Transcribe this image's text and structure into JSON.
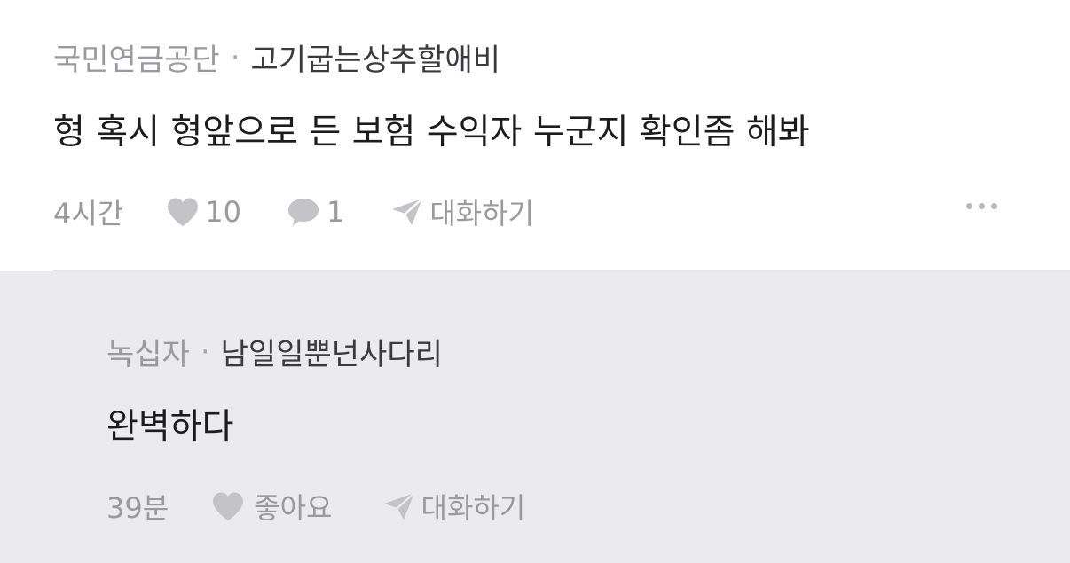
{
  "comment": {
    "company": "국민연금공단",
    "separator": "·",
    "nickname": "고기굽는상추할애비",
    "body": "형 혹시 형앞으로 든 보험 수익자 누군지 확인좀 해봐",
    "time": "4시간",
    "likes": "10",
    "replies": "1",
    "chat_label": "대화하기",
    "icons": {
      "like": "heart-icon",
      "reply": "speech-bubble-icon",
      "chat": "paper-plane-icon",
      "more": "more-dots-icon"
    }
  },
  "reply": {
    "company": "녹십자",
    "separator": "·",
    "nickname": "남일일뿐넌사다리",
    "body": "완벽하다",
    "time": "39분",
    "like_label": "좋아요",
    "chat_label": "대화하기",
    "icons": {
      "like": "heart-icon",
      "chat": "paper-plane-icon"
    }
  },
  "colors": {
    "muted_text": "#9a9a9e",
    "body_text": "#1c1c1e",
    "icon_gray": "#c4c4c8",
    "reply_background": "#ebebef"
  }
}
